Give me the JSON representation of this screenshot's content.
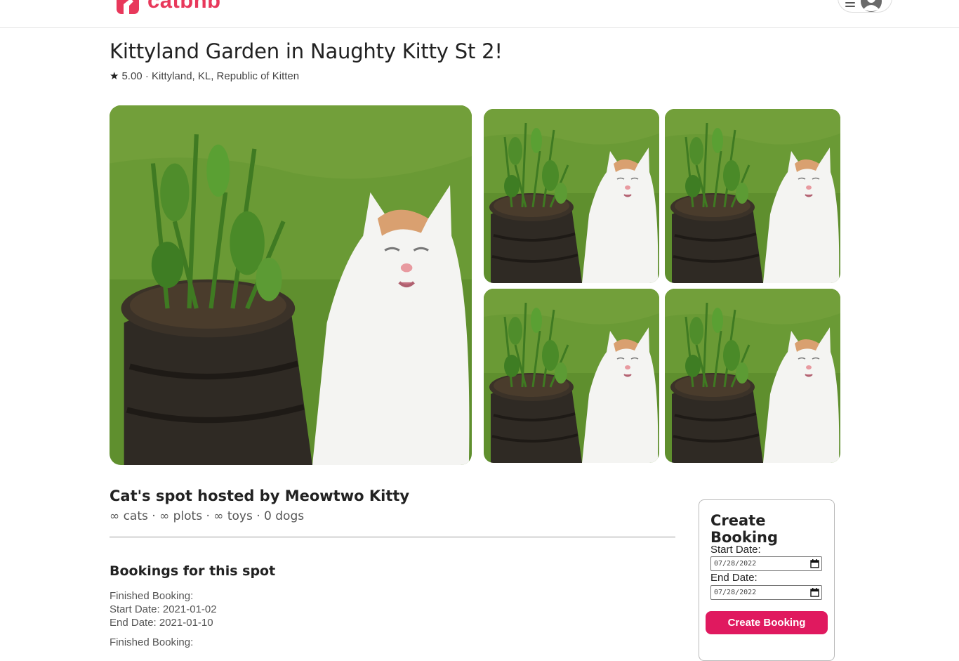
{
  "header": {
    "logo_text": "catbnb",
    "brand_color": "#e8385b",
    "menu_icon": "hamburger-icon",
    "avatar_icon": "user-avatar-icon"
  },
  "listing": {
    "title": "Kittyland Garden in Naughty Kitty St 2!",
    "rating_icon": "star",
    "rating": "5.00",
    "separator": "·",
    "location": "Kittyland, KL, Republic of Kitten"
  },
  "gallery": {
    "image_count": 5
  },
  "host": {
    "title": "Cat's spot hosted by Meowtwo Kitty",
    "details": "∞ cats · ∞ plots · ∞ toys · 0 dogs"
  },
  "bookings": {
    "title": "Bookings for this spot",
    "items": [
      {
        "status": "Finished Booking:",
        "start": "Start Date: 2021-01-02",
        "end": "End Date: 2021-01-10"
      },
      {
        "status": "Finished Booking:"
      }
    ]
  },
  "booking_form": {
    "title": "Create Booking",
    "start_label": "Start Date:",
    "start_value": "07/28/2022",
    "end_label": "End Date:",
    "end_value": "07/28/2022",
    "button_label": "Create Booking",
    "button_color": "#e0195f"
  }
}
